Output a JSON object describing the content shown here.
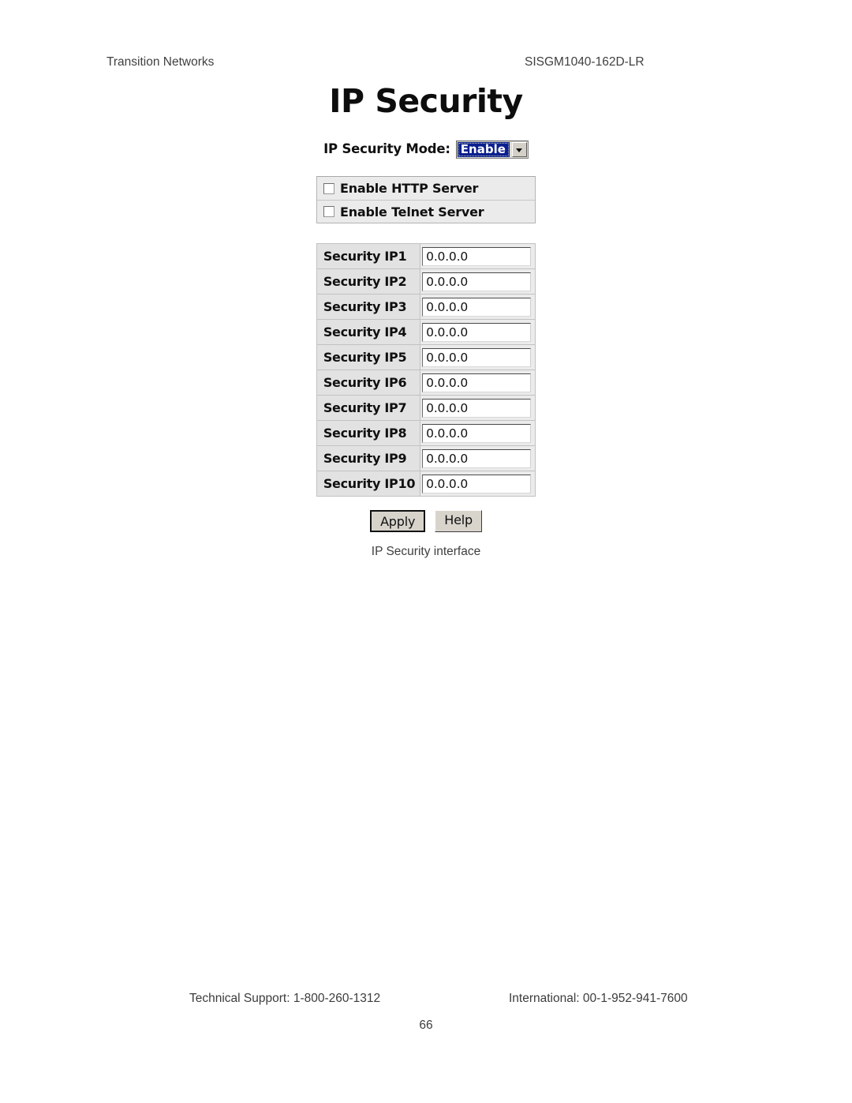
{
  "header": {
    "company": "Transition Networks",
    "model": "SISGM1040-162D-LR"
  },
  "screen": {
    "title": "IP Security",
    "mode": {
      "label": "IP Security Mode:",
      "value": "Enable",
      "arrow_icon": "chevron-down-icon"
    },
    "checkboxes": [
      {
        "label": "Enable HTTP Server",
        "checked": false
      },
      {
        "label": "Enable Telnet Server",
        "checked": false
      }
    ],
    "ip_rows": [
      {
        "label": "Security IP1",
        "value": "0.0.0.0"
      },
      {
        "label": "Security IP2",
        "value": "0.0.0.0"
      },
      {
        "label": "Security IP3",
        "value": "0.0.0.0"
      },
      {
        "label": "Security IP4",
        "value": "0.0.0.0"
      },
      {
        "label": "Security IP5",
        "value": "0.0.0.0"
      },
      {
        "label": "Security IP6",
        "value": "0.0.0.0"
      },
      {
        "label": "Security IP7",
        "value": "0.0.0.0"
      },
      {
        "label": "Security IP8",
        "value": "0.0.0.0"
      },
      {
        "label": "Security IP9",
        "value": "0.0.0.0"
      },
      {
        "label": "Security IP10",
        "value": "0.0.0.0"
      }
    ],
    "buttons": {
      "apply": "Apply",
      "help": "Help"
    },
    "colors": {
      "selection_blue": "#0a1f8f",
      "selection_text": "#ffffff",
      "button_face": "#d4d0c8",
      "row_background": "#e2e2e2"
    }
  },
  "caption": "IP Security interface",
  "footer": {
    "support": "Technical Support: 1-800-260-1312",
    "international": "International: 00-1-952-941-7600",
    "page_number": "66"
  }
}
